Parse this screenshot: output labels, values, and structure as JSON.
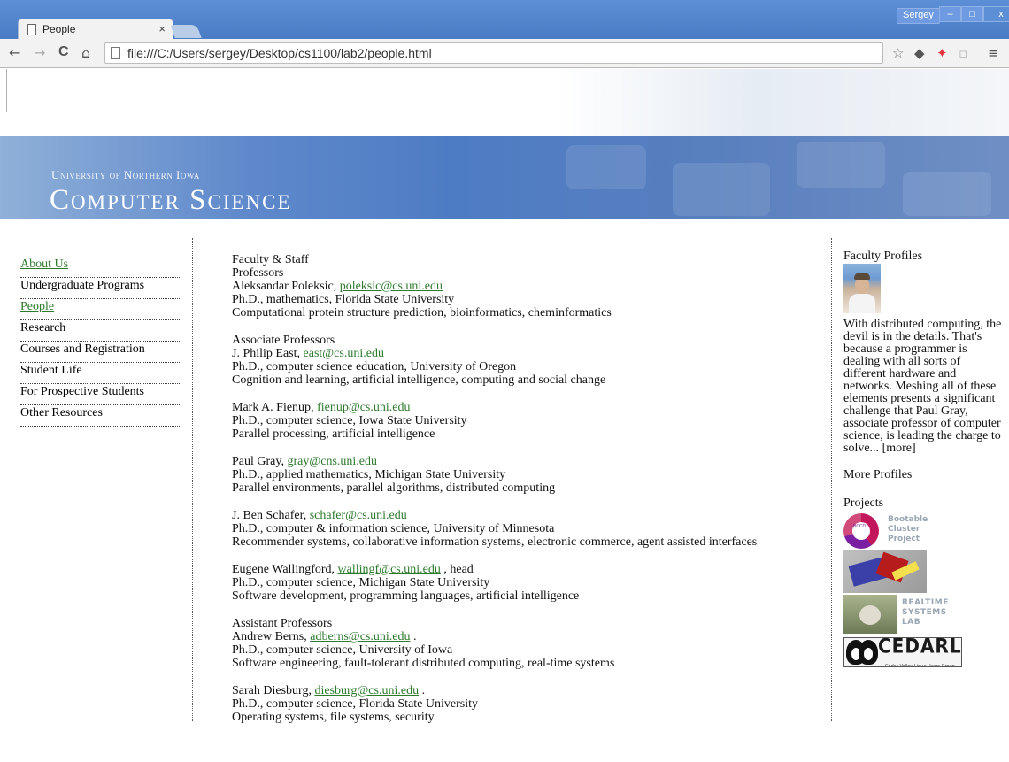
{
  "browser": {
    "tab_title": "People",
    "tab_close": "×",
    "user_name": "Sergey",
    "min_glyph": "–",
    "max_glyph": "□",
    "close_glyph": "x",
    "url": "file:///C:/Users/sergey/Desktop/cs1100/lab2/people.html",
    "nav": {
      "back": "←",
      "forward": "→",
      "reload": "C",
      "home": "⌂"
    },
    "toolbar_icons": {
      "bookmark": "☆",
      "pocket": "◆",
      "color": "✦",
      "pdf": "▫",
      "menu": "≡"
    }
  },
  "header": {
    "university": "University of Northern Iowa",
    "department": "Computer Science"
  },
  "leftnav": [
    {
      "label": "About Us",
      "style": "green"
    },
    {
      "label": "Undergraduate Programs",
      "style": "plain"
    },
    {
      "label": "People",
      "style": "green"
    },
    {
      "label": "Research",
      "style": "plain"
    },
    {
      "label": "Courses and Registration",
      "style": "plain"
    },
    {
      "label": "Student Life",
      "style": "plain"
    },
    {
      "label": "For Prospective Students",
      "style": "plain"
    },
    {
      "label": "Other Resources",
      "style": "plain"
    }
  ],
  "main": {
    "heading": "Faculty & Staff",
    "sections": [
      {
        "title": "Professors",
        "people": [
          {
            "name": "Aleksandar Poleksic, ",
            "email": "poleksic@cs.uni.edu",
            "suffix": "",
            "degree": "Ph.D., mathematics, Florida State University",
            "interests": "Computational protein structure prediction, bioinformatics, cheminformatics"
          }
        ]
      },
      {
        "title": "Associate Professors",
        "people": [
          {
            "name": "J. Philip East, ",
            "email": "east@cs.uni.edu",
            "suffix": "",
            "degree": "Ph.D., computer science education, University of Oregon",
            "interests": "Cognition and learning, artificial intelligence, computing and social change"
          },
          {
            "name": "Mark A. Fienup, ",
            "email": "fienup@cs.uni.edu",
            "suffix": "",
            "degree": "Ph.D., computer science, Iowa State University",
            "interests": "Parallel processing, artificial intelligence"
          },
          {
            "name": "Paul Gray, ",
            "email": "gray@cns.uni.edu",
            "suffix": "",
            "degree": "Ph.D., applied mathematics, Michigan State University",
            "interests": "Parallel environments, parallel algorithms, distributed computing"
          },
          {
            "name": "J. Ben Schafer, ",
            "email": "schafer@cs.uni.edu",
            "suffix": "",
            "degree": "Ph.D., computer & information science, University of Minnesota",
            "interests": "Recommender systems, collaborative information systems, electronic commerce, agent assisted interfaces"
          },
          {
            "name": "Eugene Wallingford, ",
            "email": "wallingf@cs.uni.edu",
            "suffix": " , head",
            "degree": "Ph.D., computer science, Michigan State University",
            "interests": "Software development, programming languages, artificial intelligence"
          }
        ]
      },
      {
        "title": "Assistant Professors",
        "people": [
          {
            "name": "Andrew Berns, ",
            "email": "adberns@cs.uni.edu",
            "suffix": " .",
            "degree": "Ph.D., computer science, University of Iowa",
            "interests": "Software engineering, fault-tolerant distributed computing, real-time systems"
          },
          {
            "name": "Sarah Diesburg, ",
            "email": "diesburg@cs.uni.edu",
            "suffix": " .",
            "degree": "Ph.D., computer science, Florida State University",
            "interests": "Operating systems, file systems, security"
          }
        ]
      }
    ]
  },
  "sidebar": {
    "profiles_title": "Faculty Profiles",
    "profile_text": "With distributed computing, the devil is in the details. That's because a programmer is dealing with all sorts of different hardware and networks. Meshing all of these elements presents a significant challenge that Paul Gray, associate professor of computer science, is leading the charge to solve... ",
    "more_link": "[more]",
    "more_profiles": "More Profiles",
    "projects_title": "Projects",
    "projects": {
      "bccd_badge": "BCCD",
      "bccd_text": [
        "Bootable",
        "Cluster",
        "Project"
      ],
      "rtsl_text": [
        "REALTIME",
        "SYSTEMS",
        "LAB"
      ],
      "lug_text": "CEDARLUG",
      "lug_tagline": "Cedar Valley Linux Users Group"
    }
  }
}
